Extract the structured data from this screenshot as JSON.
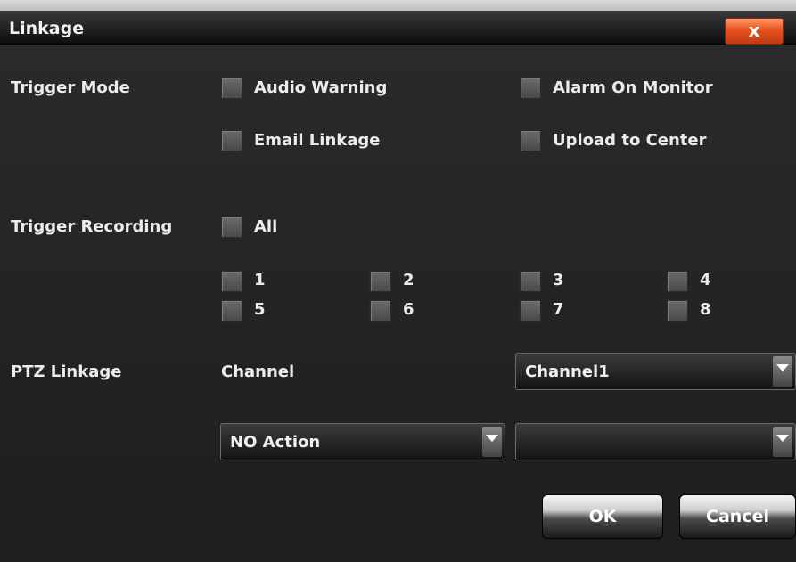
{
  "window": {
    "title": "Linkage",
    "close_glyph": "x"
  },
  "trigger_mode": {
    "label": "Trigger Mode",
    "options": [
      {
        "label": "Audio Warning",
        "checked": false
      },
      {
        "label": "Alarm On Monitor",
        "checked": false
      },
      {
        "label": "Email Linkage",
        "checked": false
      },
      {
        "label": "Upload to Center",
        "checked": false
      }
    ]
  },
  "trigger_recording": {
    "label": "Trigger Recording",
    "all_label": "All",
    "all_checked": false,
    "channels": [
      {
        "label": "1",
        "checked": false
      },
      {
        "label": "2",
        "checked": false
      },
      {
        "label": "3",
        "checked": false
      },
      {
        "label": "4",
        "checked": false
      },
      {
        "label": "5",
        "checked": false
      },
      {
        "label": "6",
        "checked": false
      },
      {
        "label": "7",
        "checked": false
      },
      {
        "label": "8",
        "checked": false
      }
    ]
  },
  "ptz_linkage": {
    "label": "PTZ Linkage",
    "channel_label": "Channel",
    "channel_value": "Channel1",
    "action_value": "NO Action",
    "param_value": ""
  },
  "buttons": {
    "ok": "OK",
    "cancel": "Cancel"
  },
  "colors": {
    "background": "#1e1e1e",
    "title_bar": "#0e0e0e",
    "close_button": "#e8501c",
    "text": "#ececec",
    "checkbox": "#5a5a5a"
  },
  "icons": {
    "close": "close-icon",
    "dropdown": "chevron-down-icon"
  }
}
